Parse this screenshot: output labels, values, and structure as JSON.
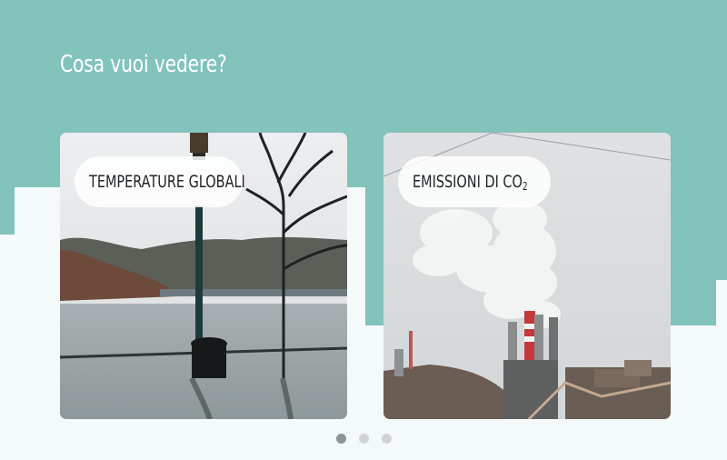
{
  "section": {
    "heading": "Cosa vuoi vedere?"
  },
  "cards": [
    {
      "title": "TEMPERATURE GLOBALI",
      "image": "flooded-lakeside-streetlamp-photo"
    },
    {
      "title_main": "EMISSIONI DI CO",
      "title_sub": "2",
      "image": "industrial-smokestacks-photo"
    }
  ],
  "carousel": {
    "total_pages": 3,
    "active_page": 1
  },
  "colors": {
    "teal_background": "#82c3bc",
    "light_background": "#f4f9f9",
    "heading_text": "#ffffff",
    "pill_background": "#ffffff",
    "pill_text": "#1f2326",
    "dot_active": "#8a9499",
    "dot_inactive": "#d0d4d6"
  }
}
